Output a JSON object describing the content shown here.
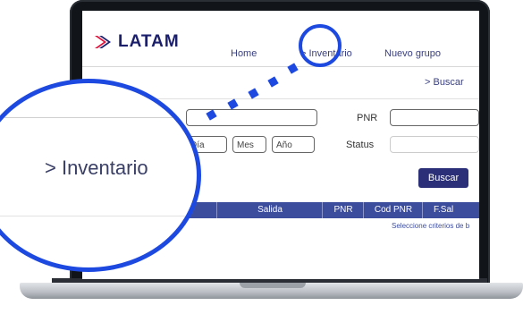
{
  "brand": {
    "logo_text": "LATAM",
    "logo_color": "#1b1f6b",
    "accent_color": "#e0103a"
  },
  "nav": {
    "items": [
      {
        "label": "Home"
      },
      {
        "label": "> Inventario"
      },
      {
        "label": "Nuevo grupo"
      }
    ]
  },
  "breadcrumb": {
    "label": "> Buscar"
  },
  "form": {
    "pnr_label": "PNR",
    "status_label": "Status",
    "dia_placeholder": "Día",
    "mes_placeholder": "Mes",
    "anio_placeholder": "Año",
    "search_button": "Buscar"
  },
  "table": {
    "headers": [
      "Salida",
      "PNR",
      "Cod PNR",
      "F.Sal"
    ],
    "empty_message": "Seleccione criterios de b"
  },
  "zoom": {
    "label": "> Inventario",
    "highlight_color": "#1d49e0"
  }
}
